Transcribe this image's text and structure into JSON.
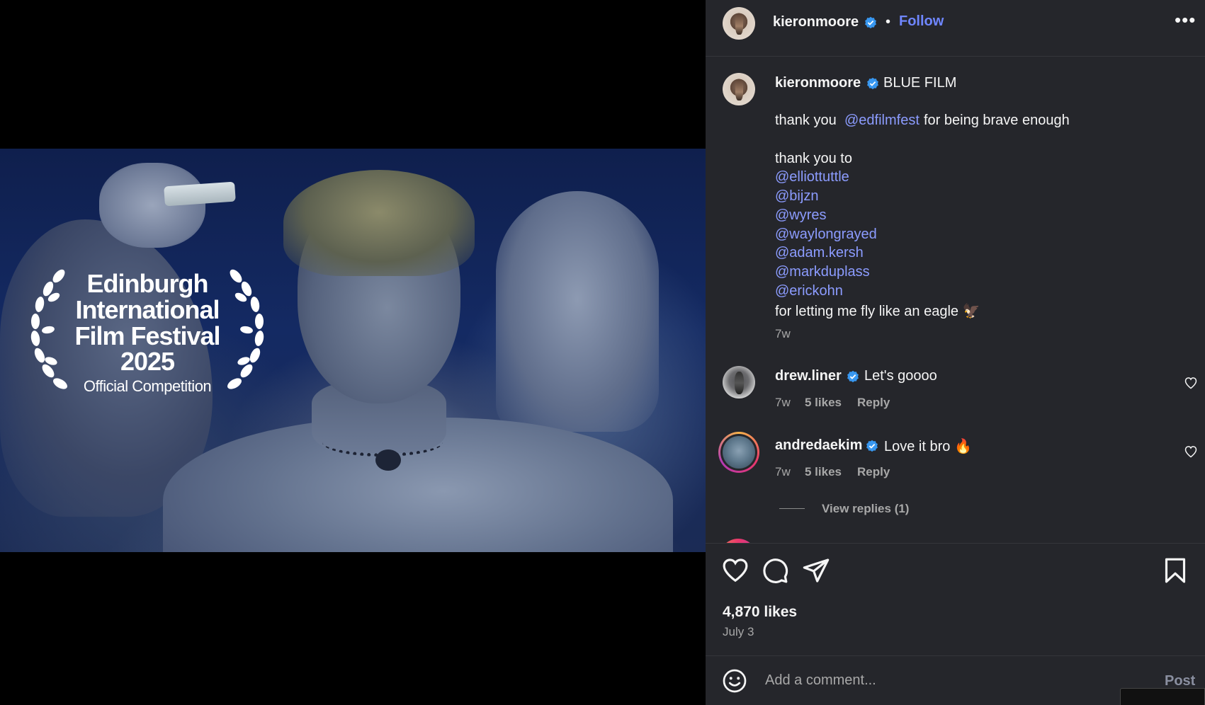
{
  "post": {
    "username": "kieronmoore",
    "follow_label": "Follow",
    "separator": "•",
    "more_label": "•••"
  },
  "media": {
    "badge": {
      "line1": "Edinburgh",
      "line2": "International",
      "line3": "Film Festival",
      "line4": "2025",
      "line5": "Official Competition"
    }
  },
  "caption": {
    "username": "kieronmoore",
    "title": "BLUE FILM",
    "line1_prefix": "thank you ",
    "line1_mention": "@edfilmfest",
    "line1_suffix": " for being brave enough",
    "line2": "thank you to",
    "mentions": [
      "@elliottuttle",
      "@bijzn",
      "@wyres",
      "@waylongrayed",
      "@adam.kersh",
      "@markduplass",
      "@erickohn"
    ],
    "closing": "for letting me fly like an eagle 🦅",
    "time": "7w"
  },
  "comments": [
    {
      "username": "drew.liner",
      "text": "Let's goooo",
      "time": "7w",
      "likes": "5 likes",
      "reply_label": "Reply"
    },
    {
      "username": "andredaekim",
      "text": "Love it bro 🔥",
      "time": "7w",
      "likes": "5 likes",
      "reply_label": "Reply",
      "view_replies": "View replies (1)"
    }
  ],
  "actions": {
    "likes": "4,870 likes",
    "date": "July 3"
  },
  "composer": {
    "placeholder": "Add a comment...",
    "post_label": "Post"
  },
  "colors": {
    "panel_bg": "#25262b",
    "link": "#8c9cff",
    "follow": "#6f86ff",
    "verified": "#3897f0"
  }
}
